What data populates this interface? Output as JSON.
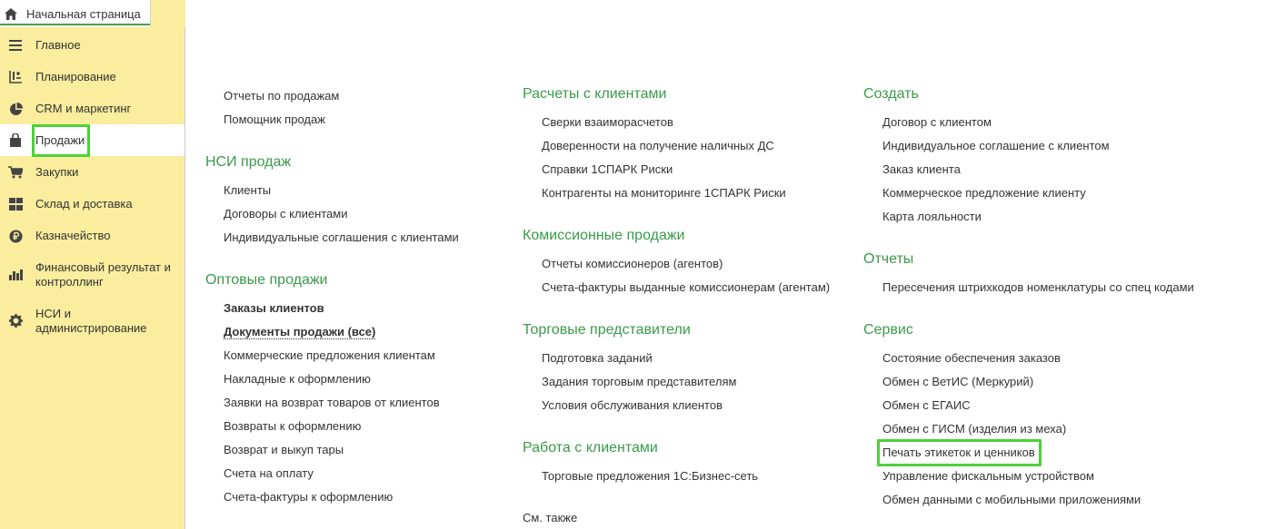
{
  "home_tab": {
    "label": "Начальная страница",
    "icon": "home-icon"
  },
  "colors": {
    "sidebar_bg": "#fbed9e",
    "heading": "#3a9a4a",
    "highlight": "#4cd137"
  },
  "sidebar": {
    "items": [
      {
        "label": "Главное",
        "icon": "menu-lines-icon"
      },
      {
        "label": "Планирование",
        "icon": "planning-icon"
      },
      {
        "label": "CRM и маркетинг",
        "icon": "pie-chart-icon"
      },
      {
        "label": "Продажи",
        "icon": "shopping-bag-icon",
        "active": true
      },
      {
        "label": "Закупки",
        "icon": "cart-icon"
      },
      {
        "label": "Склад и доставка",
        "icon": "warehouse-icon"
      },
      {
        "label": "Казначейство",
        "icon": "ruble-icon"
      },
      {
        "label": "Финансовый результат и",
        "label2": "контроллинг",
        "icon": "bar-chart-icon"
      },
      {
        "label": "НСИ и",
        "label2": "администрирование",
        "icon": "gear-icon"
      }
    ]
  },
  "col1": {
    "top_links": [
      "Отчеты по продажам",
      "Помощник продаж"
    ],
    "nsi": {
      "heading": "НСИ продаж",
      "links": [
        "Клиенты",
        "Договоры с клиентами",
        "Индивидуальные соглашения с клиентами"
      ]
    },
    "wholesale": {
      "heading": "Оптовые продажи",
      "links": [
        "Заказы клиентов",
        "Документы продажи (все)",
        "Коммерческие предложения клиентам",
        "Накладные к оформлению",
        "Заявки на возврат товаров от клиентов",
        "Возвраты к оформлению",
        "Возврат и выкуп тары",
        "Счета на оплату",
        "Счета-фактуры к оформлению"
      ]
    }
  },
  "col2": {
    "settlements": {
      "heading": "Расчеты с клиентами",
      "links": [
        "Сверки взаиморасчетов",
        "Доверенности на получение наличных ДС",
        "Справки 1СПАРК Риски",
        "Контрагенты на мониторинге 1СПАРК Риски"
      ]
    },
    "commission": {
      "heading": "Комиссионные продажи",
      "links": [
        "Отчеты комиссионеров (агентов)",
        "Счета-фактуры выданные комиссионерам (агентам)"
      ]
    },
    "reps": {
      "heading": "Торговые представители",
      "links": [
        "Подготовка заданий",
        "Задания торговым представителям",
        "Условия обслуживания клиентов"
      ]
    },
    "work": {
      "heading": "Работа с клиентами",
      "links": [
        "Торговые предложения 1С:Бизнес-сеть"
      ]
    },
    "see_also": "См. также"
  },
  "col3": {
    "create": {
      "heading": "Создать",
      "links": [
        "Договор с клиентом",
        "Индивидуальное соглашение с клиентом",
        "Заказ клиента",
        "Коммерческое предложение клиенту",
        "Карта лояльности"
      ]
    },
    "reports": {
      "heading": "Отчеты",
      "links": [
        "Пересечения штрихкодов номенклатуры со спец кодами"
      ]
    },
    "service": {
      "heading": "Сервис",
      "links": [
        "Состояние обеспечения заказов",
        "Обмен с ВетИС (Меркурий)",
        "Обмен с ЕГАИС",
        "Обмен с ГИСМ (изделия из меха)",
        "Печать этикеток и ценников",
        "Управление фискальным устройством",
        "Обмен данными с мобильными приложениями"
      ]
    }
  }
}
